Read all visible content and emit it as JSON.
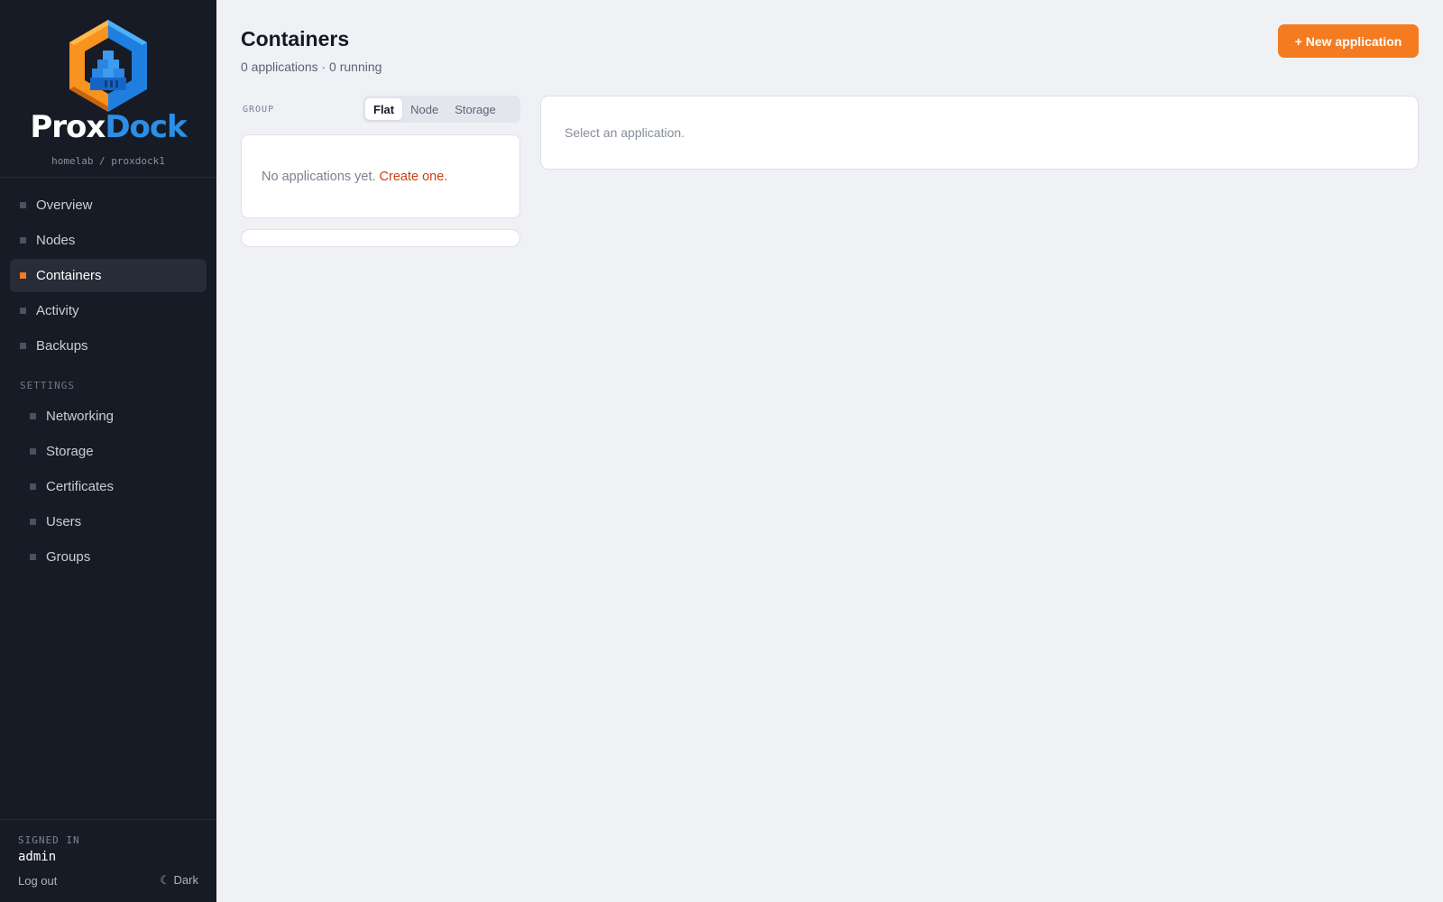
{
  "brand": {
    "name_part1": "Prox",
    "name_part2": "Dock",
    "path": "homelab / proxdock1"
  },
  "sidebar": {
    "items": [
      {
        "label": "Overview",
        "active": false
      },
      {
        "label": "Nodes",
        "active": false
      },
      {
        "label": "Containers",
        "active": true
      },
      {
        "label": "Activity",
        "active": false
      },
      {
        "label": "Backups",
        "active": false
      }
    ],
    "settings_label": "SETTINGS",
    "settings_items": [
      {
        "label": "Networking"
      },
      {
        "label": "Storage"
      },
      {
        "label": "Certificates"
      },
      {
        "label": "Users"
      },
      {
        "label": "Groups"
      }
    ],
    "footer": {
      "signed_in_label": "SIGNED IN",
      "username": "admin",
      "logout_label": "Log out",
      "theme_label": "Dark",
      "theme_icon": "moon-icon"
    }
  },
  "main": {
    "title": "Containers",
    "subtitle": "0 applications · 0 running",
    "new_button": "+ New application",
    "group": {
      "label": "GROUP",
      "options": [
        "Flat",
        "Node",
        "Storage"
      ],
      "selected": "Flat"
    },
    "empty_text": "No applications yet.",
    "create_link": "Create one.",
    "detail_placeholder": "Select an application."
  },
  "colors": {
    "accent": "#f47b20",
    "sidebar_bg": "#161b25",
    "page_bg": "#eff1f5",
    "brand_blue": "#2b8fe8",
    "link": "#c8400e"
  }
}
